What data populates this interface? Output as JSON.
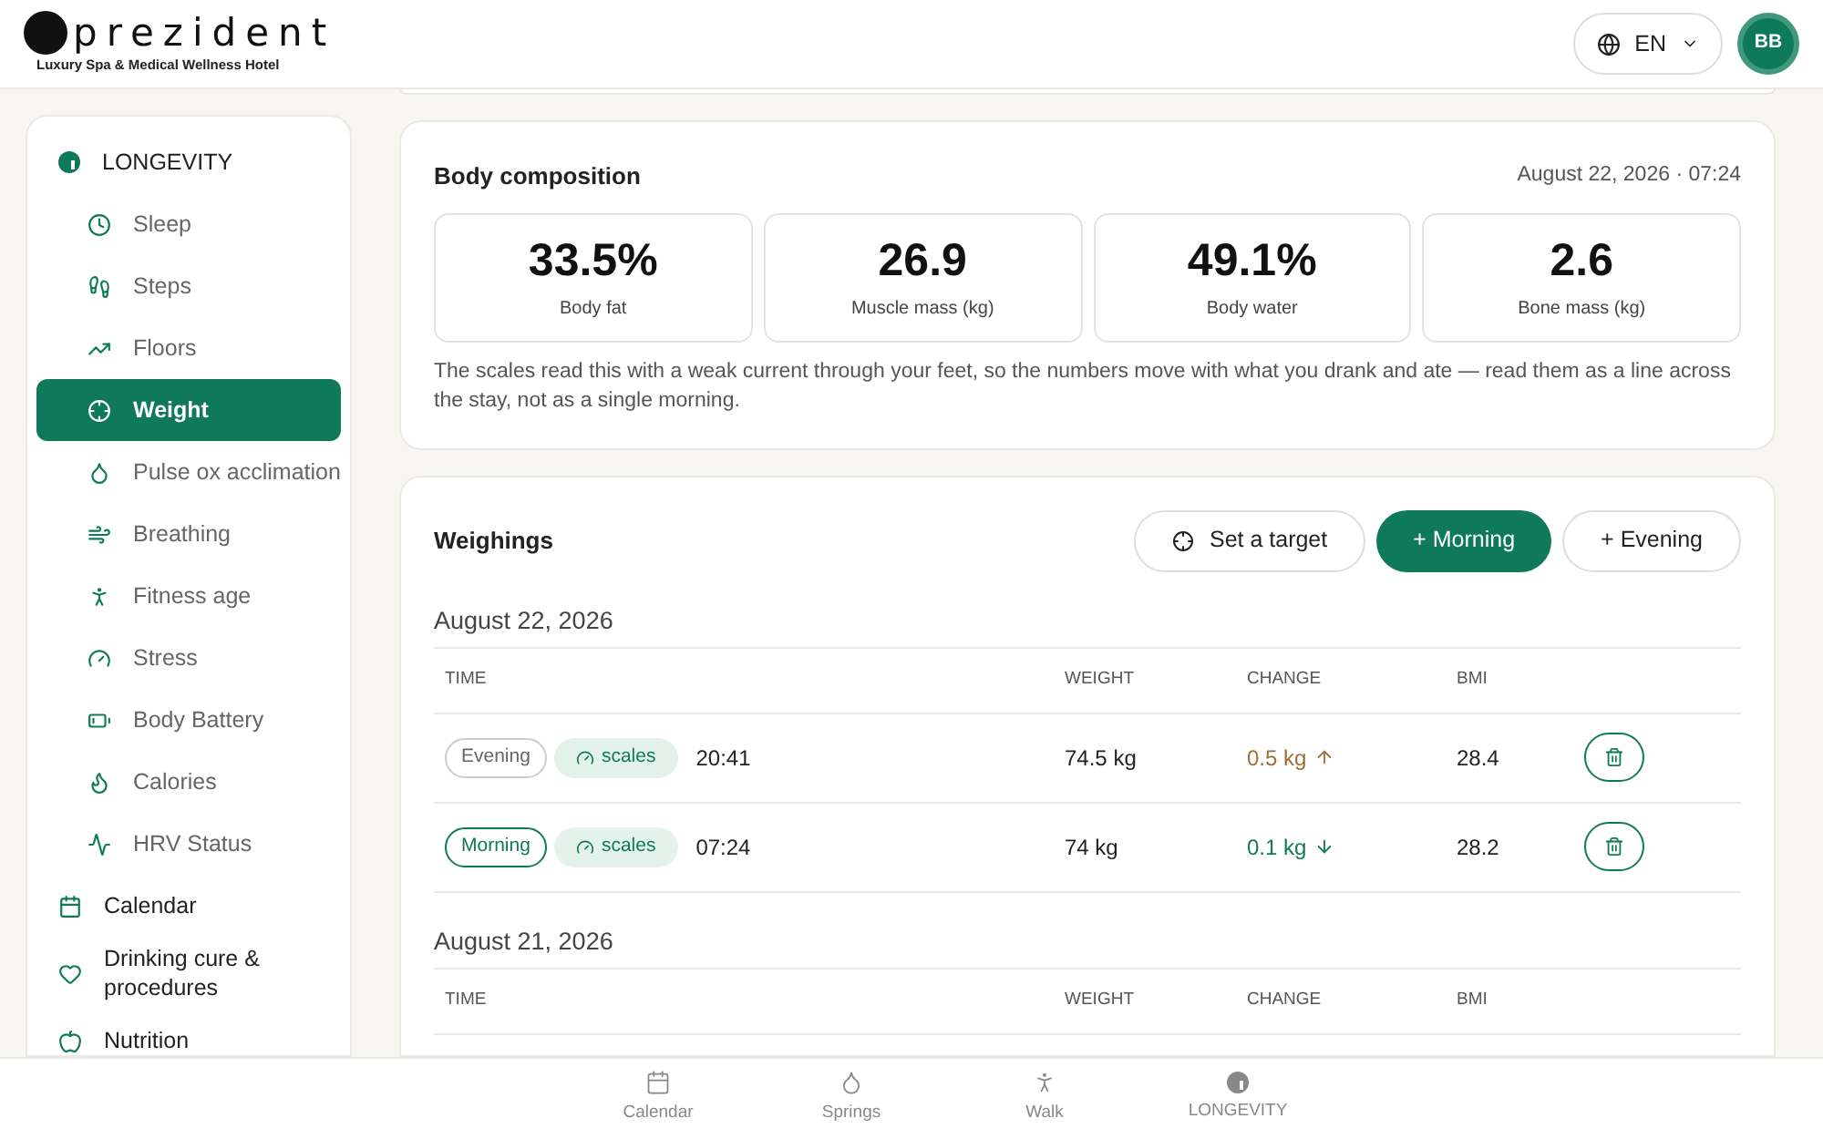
{
  "header": {
    "logo": {
      "word": "prezident",
      "tagline": "Luxury Spa & Medical Wellness Hotel"
    },
    "language": "EN",
    "avatar": "BB"
  },
  "sidebar": {
    "items": [
      {
        "label": "LONGEVITY",
        "selected": false,
        "children": [
          {
            "label": "Sleep",
            "selected": false
          },
          {
            "label": "Steps",
            "selected": false
          },
          {
            "label": "Floors",
            "selected": false
          },
          {
            "label": "Weight",
            "selected": true
          },
          {
            "label": "Pulse ox acclimation",
            "selected": false
          },
          {
            "label": "Breathing",
            "selected": false
          },
          {
            "label": "Fitness age",
            "selected": false
          },
          {
            "label": "Stress",
            "selected": false
          },
          {
            "label": "Body Battery",
            "selected": false
          },
          {
            "label": "Calories",
            "selected": false
          },
          {
            "label": "HRV Status",
            "selected": false
          }
        ]
      },
      {
        "label": "Calendar",
        "selected": false
      },
      {
        "label": "Drinking cure & procedures",
        "selected": false
      },
      {
        "label": "Nutrition",
        "selected": false
      }
    ]
  },
  "body_composition": {
    "title": "Body composition",
    "timestamp": "August 22, 2026 · 07:24",
    "metrics": [
      {
        "value": "33.5%",
        "label": "Body fat"
      },
      {
        "value": "26.9",
        "label": "Muscle mass (kg)"
      },
      {
        "value": "49.1%",
        "label": "Body water"
      },
      {
        "value": "2.6",
        "label": "Bone mass (kg)"
      }
    ],
    "note": "The scales read this with a weak current through your feet, so the numbers move with what you drank and ate — read them as a line across the stay, not as a single morning."
  },
  "weighings": {
    "title": "Weighings",
    "buttons": [
      {
        "label": "Set a target",
        "kind": "target"
      },
      {
        "label": "+ Morning",
        "kind": "primary"
      },
      {
        "label": "+ Evening",
        "kind": "secondary"
      }
    ],
    "days": [
      {
        "date": "August 22, 2026",
        "columns": [
          "TIME",
          "WEIGHT",
          "CHANGE",
          "BMI"
        ],
        "rows": [
          {
            "period": "Evening",
            "kind": "evening",
            "source": "scales",
            "time": "20:41",
            "weight": "74.5 kg",
            "change": "0.5 kg",
            "increase": true,
            "bmi": "28.4"
          },
          {
            "period": "Morning",
            "kind": "morning",
            "source": "scales",
            "time": "07:24",
            "weight": "74 kg",
            "change": "0.1 kg",
            "increase": false,
            "bmi": "28.2"
          }
        ]
      },
      {
        "date": "August 21, 2026",
        "columns": [
          "TIME",
          "WEIGHT",
          "CHANGE",
          "BMI"
        ]
      }
    ]
  },
  "bottom_nav": [
    {
      "label": "Calendar",
      "selected": false
    },
    {
      "label": "Springs",
      "selected": false
    },
    {
      "label": "Walk",
      "selected": false
    },
    {
      "label": "LONGEVITY",
      "selected": false
    }
  ]
}
